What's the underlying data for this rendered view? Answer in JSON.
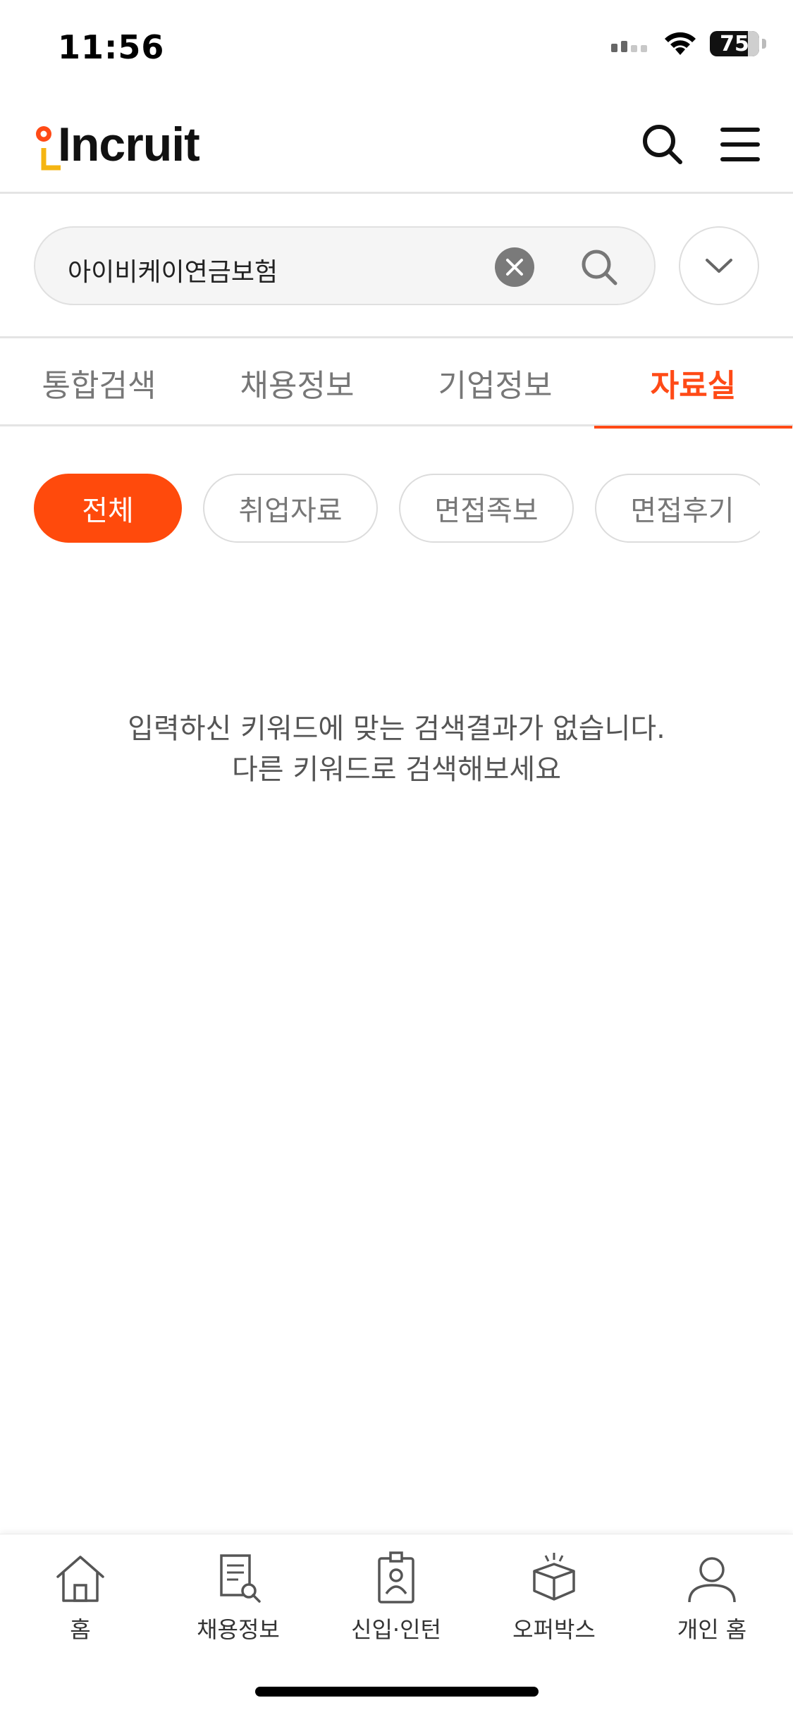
{
  "status_bar": {
    "time": "11:56",
    "battery": "75"
  },
  "header": {
    "logo": "Incruit"
  },
  "search": {
    "query": "아이비케이연금보험"
  },
  "tabs": [
    {
      "label": "통합검색"
    },
    {
      "label": "채용정보"
    },
    {
      "label": "기업정보"
    },
    {
      "label": "자료실"
    }
  ],
  "active_tab": "자료실",
  "chips": [
    {
      "label": "전체"
    },
    {
      "label": "취업자료"
    },
    {
      "label": "면접족보"
    },
    {
      "label": "면접후기"
    }
  ],
  "empty_message": {
    "line1": "입력하신 키워드에 맞는 검색결과가 없습니다.",
    "line2": "다른 키워드로 검색해보세요"
  },
  "bottom_nav": [
    {
      "label": "홈",
      "icon": "home-icon"
    },
    {
      "label": "채용정보",
      "icon": "job-document-icon"
    },
    {
      "label": "신입·인턴",
      "icon": "id-badge-icon"
    },
    {
      "label": "오퍼박스",
      "icon": "gift-box-icon"
    },
    {
      "label": "개인 홈",
      "icon": "person-icon"
    }
  ],
  "colors": {
    "accent": "#ff4a16",
    "text_muted": "#777777"
  }
}
